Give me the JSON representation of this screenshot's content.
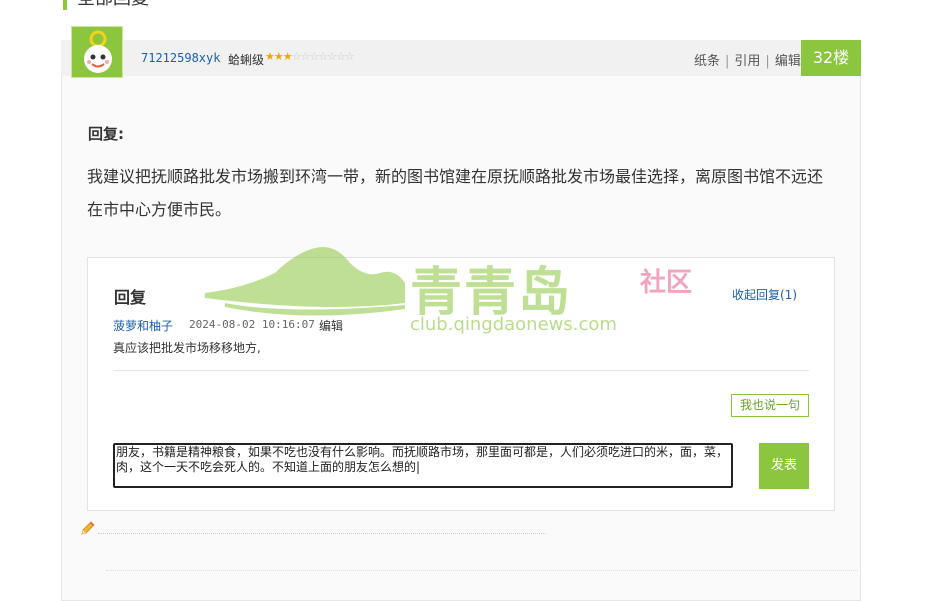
{
  "section": {
    "title": "全部回复"
  },
  "post": {
    "username": "71212598xyk",
    "rank_label": "蛤蜊级",
    "stars": {
      "filled": 3,
      "total": 10
    },
    "actions": [
      "纸条",
      "引用",
      "编辑"
    ],
    "floor": "32楼",
    "reply_label": "回复:",
    "content": "我建议把抚顺路批发市场搬到环湾一带，新的图书馆建在原抚顺路批发市场最佳选择，离原图书馆不远还在市中心方便市民。"
  },
  "sub_replies": {
    "title": "回复",
    "collapse_label": "收起回复(1)",
    "comment": {
      "user": "菠萝和柚子",
      "time": "2024-08-02 10:16:07",
      "edit_label": "编辑",
      "text": "真应该把批发市场移移地方,"
    },
    "say_button": "我也说一句",
    "input_value": "朋友，书籍是精神粮食，如果不吃也没有什么影响。而抚顺路市场，那里面可都是，人们必须吃进口的米，面，菜，肉，这个一天不吃会死人的。不知道上面的朋友怎么想的|",
    "submit_label": "发表"
  },
  "watermark": {
    "name": "青青岛",
    "tag": "社区",
    "url": "club.qingdaonews.com"
  },
  "colors": {
    "accent": "#8cc63f",
    "link": "#1d5fa8"
  }
}
